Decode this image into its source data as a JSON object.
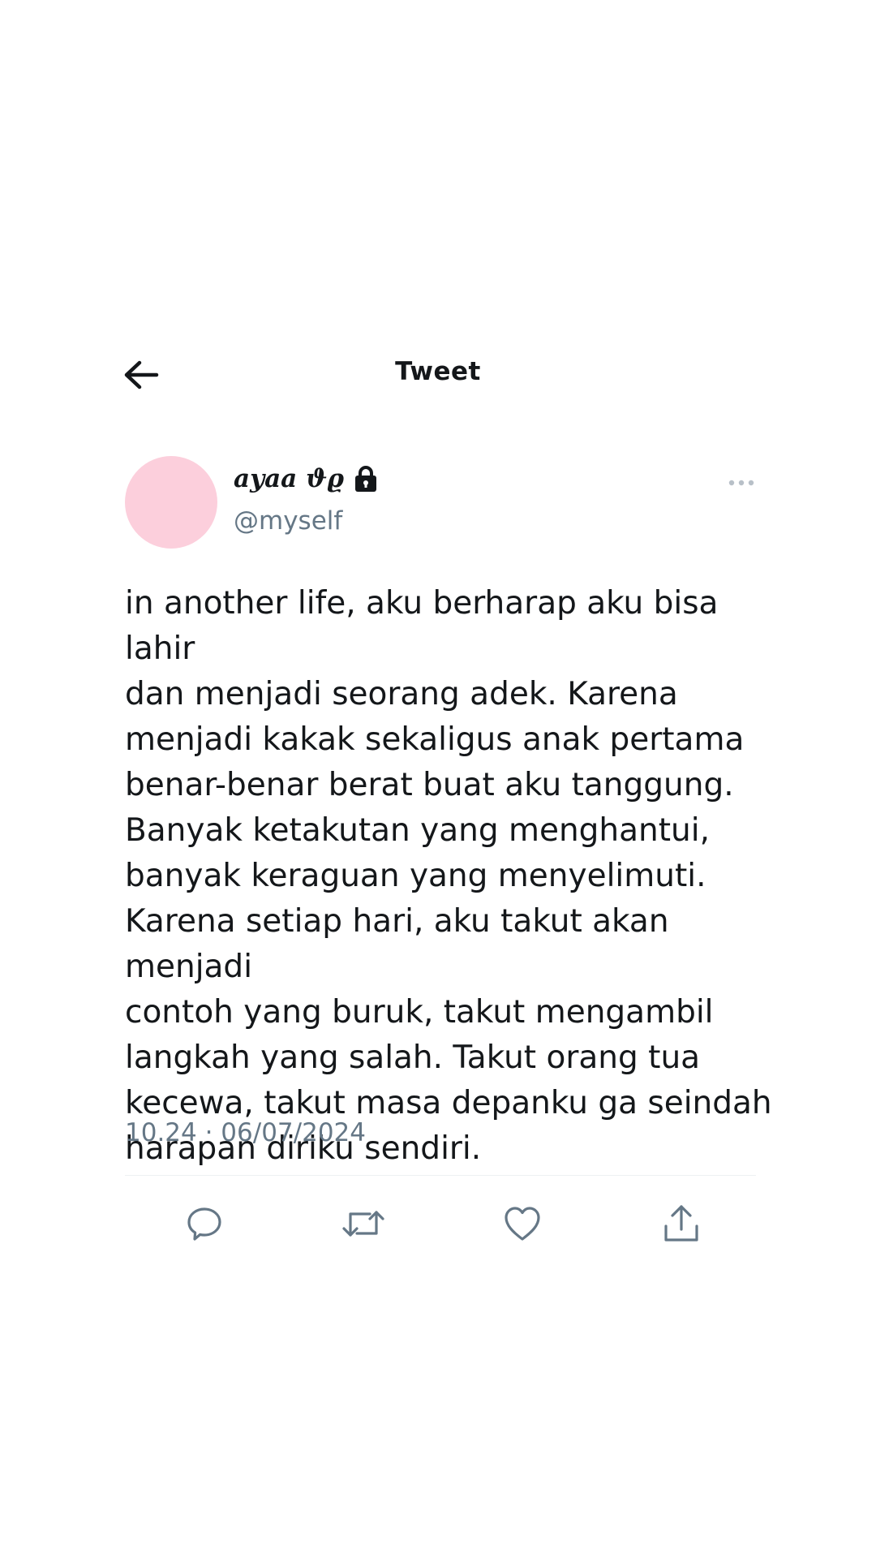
{
  "header": {
    "title": "Tweet",
    "back_icon": "arrow-left-icon"
  },
  "author": {
    "display_name": "ayaa ϑϱ",
    "handle": "@myself",
    "avatar_color": "#fccfdc",
    "protected_icon": "lock-icon",
    "more_icon": "more-horizontal-icon"
  },
  "tweet": {
    "text": "in another life, aku berharap aku bisa lahir\ndan menjadi seorang adek. Karena\nmenjadi kakak sekaligus anak pertama\nbenar-benar berat buat aku tanggung.\nBanyak ketakutan yang menghantui,\nbanyak keraguan yang menyelimuti.\nKarena setiap hari, aku takut akan menjadi\ncontoh yang buruk, takut mengambil\nlangkah yang salah. Takut orang tua\nkecewa, takut masa depanku ga seindah\nharapan diriku sendiri.",
    "timestamp": "10.24 · 06/07/2024"
  },
  "actions": [
    {
      "name": "reply",
      "icon": "reply-icon"
    },
    {
      "name": "retweet",
      "icon": "retweet-icon"
    },
    {
      "name": "like",
      "icon": "heart-icon"
    },
    {
      "name": "share",
      "icon": "share-icon"
    }
  ],
  "colors": {
    "text": "#14171a",
    "secondary": "#657786",
    "icon": "#657786"
  }
}
